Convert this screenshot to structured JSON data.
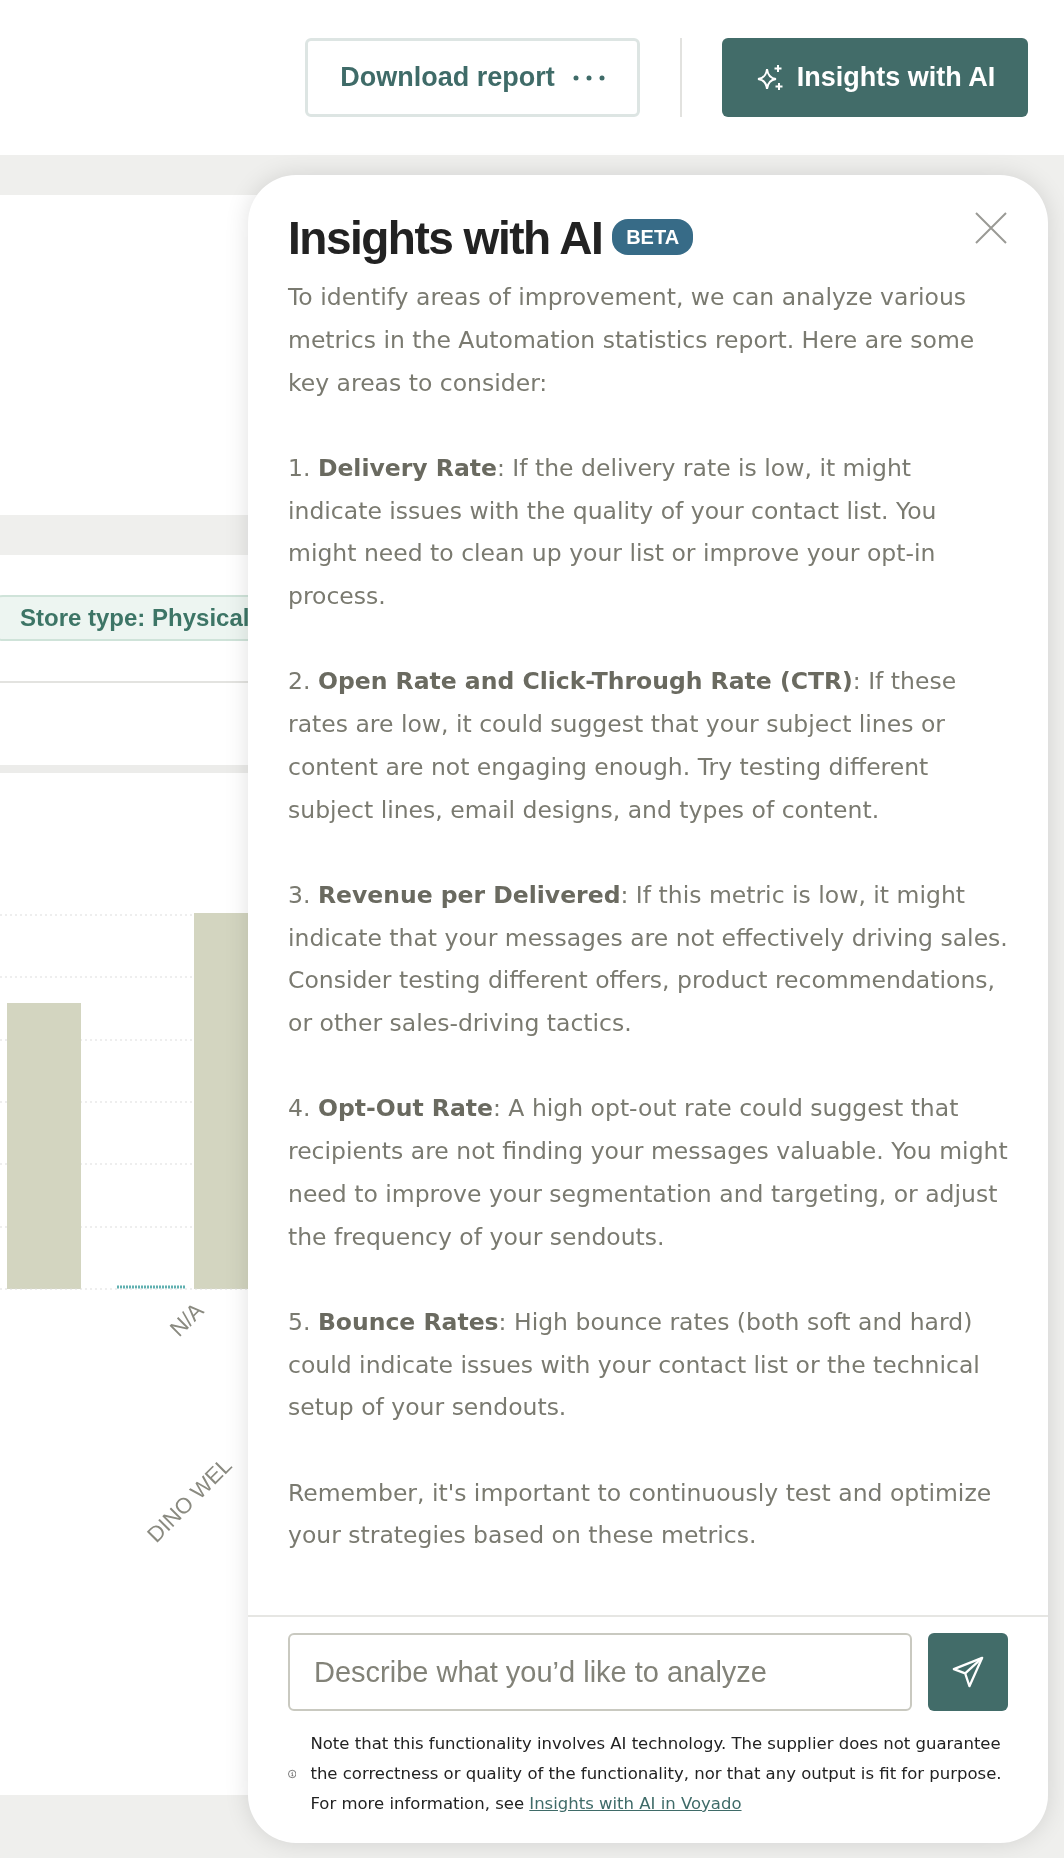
{
  "header": {
    "download_button": {
      "label": "Download report"
    },
    "ai_button": {
      "label": "Insights with AI"
    }
  },
  "background": {
    "filter_chip": {
      "label": "Store type: Physical"
    },
    "chart": {
      "axis_labels": [
        "N/A",
        "DINO WEL"
      ]
    }
  },
  "panel": {
    "title": "Insights with AI",
    "badge": "BETA",
    "paragraphs": [
      "To identify areas of improvement, we can analyze various metrics in the Automation statistics report. Here are some key areas to consider:",
      "1. **Delivery Rate**: If the delivery rate is low, it might indicate issues with the quality of your contact list. You might need to clean up your list or improve your opt-in process.",
      "2. **Open Rate and Click-Through Rate (CTR)**: If these rates are low, it could suggest that your subject lines or content are not engaging enough. Try testing different subject lines, email designs, and types of content.",
      "3. **Revenue per Delivered**: If this metric is low, it might indicate that your messages are not effectively driving sales. Consider testing different offers, product recommendations, or other sales-driving tactics.",
      "4. **Opt-Out Rate**: A high opt-out rate could suggest that recipients are not finding your messages valuable. You might need to improve your segmentation and targeting, or adjust the frequency of your sendouts.",
      "5. **Bounce Rates**: High bounce rates (both soft and hard) could indicate issues with your contact list or the technical setup of your sendouts.",
      "Remember, it's important to continuously test and optimize your strategies based on these metrics."
    ],
    "input": {
      "placeholder": "Describe what you’d like to analyze"
    },
    "disclaimer": {
      "text": "Note that this functionality involves AI technology. The supplier does not guarantee the correctness or quality of the functionality, nor that any output is fit for purpose. For more information, see",
      "link": "Insights with AI in Voyado"
    }
  }
}
